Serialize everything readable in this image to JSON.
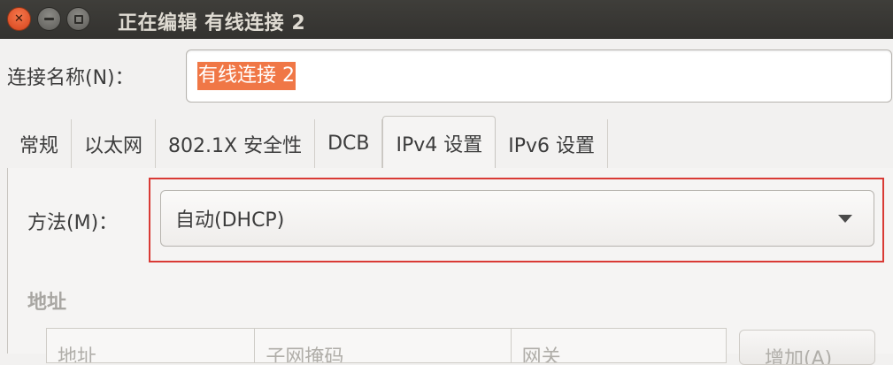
{
  "window": {
    "title": "正在编辑 有线连接 2"
  },
  "connection": {
    "name_label": "连接名称(N)：",
    "name_value": "有线连接 2"
  },
  "tabs": [
    {
      "label": "常规",
      "active": false
    },
    {
      "label": "以太网",
      "active": false
    },
    {
      "label": "802.1X 安全性",
      "active": false
    },
    {
      "label": "DCB",
      "active": false
    },
    {
      "label": "IPv4 设置",
      "active": true
    },
    {
      "label": "IPv6 设置",
      "active": false
    }
  ],
  "ipv4": {
    "method_label": "方法(M)：",
    "method_value": "自动(DHCP)",
    "address_section_label": "地址",
    "table_headers": [
      "地址",
      "子网掩码",
      "网关"
    ],
    "add_button_label": "增加(A)"
  },
  "colors": {
    "accent": "#f07746",
    "highlight": "#d93a35",
    "titlebar": "#3a3935"
  }
}
